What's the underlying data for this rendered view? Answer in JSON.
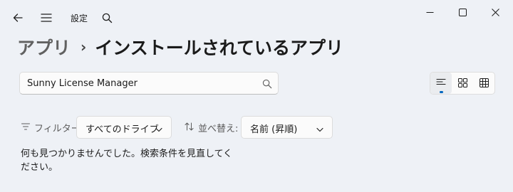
{
  "window": {
    "title": "設定",
    "icons": [
      "back-arrow-icon",
      "hamburger-menu-icon",
      "search-icon",
      "minimize-icon",
      "maximize-icon",
      "close-icon"
    ]
  },
  "breadcrumb": {
    "parent": "アプリ",
    "separator": "›",
    "current": "インストールされているアプリ"
  },
  "search": {
    "value": "Sunny License Manager"
  },
  "view_options": {
    "items": [
      "list-view-icon",
      "grid-view-icon",
      "table-view-icon"
    ],
    "active": "list-view-icon",
    "accent_color": "#0067c0"
  },
  "filter": {
    "label": "フィルター:",
    "selected": "すべてのドライブ"
  },
  "sort": {
    "label": "並べ替え:",
    "selected": "名前 (昇順)"
  },
  "results": {
    "empty_message": "何も見つかりませんでした。検索条件を見直してください。"
  }
}
